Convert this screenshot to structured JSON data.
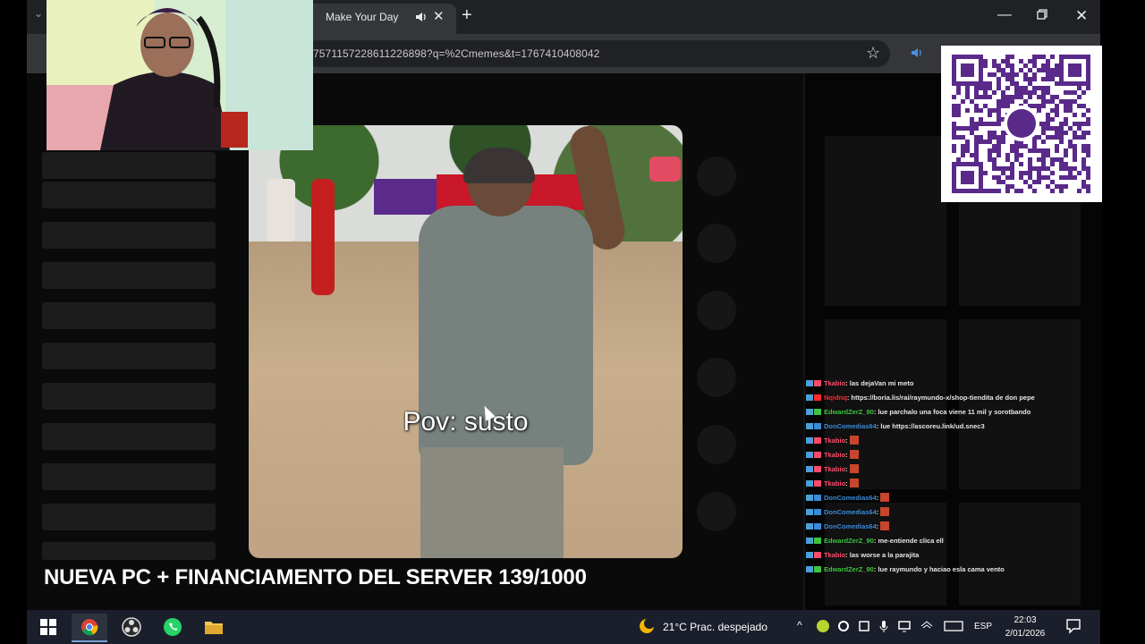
{
  "browser": {
    "tab_title": "Make Your Day",
    "tab_close": "✕",
    "new_tab": "+",
    "tab_menu": "⌄",
    "win_min": "—",
    "win_close": "✕",
    "url": "7571157228611226898?q=%2Cmemes&t=1767410408042",
    "star": "☆"
  },
  "video": {
    "caption": "Pov: susto"
  },
  "banner": {
    "text": "NUEVA PC + FINANCIAMENTO DEL SERVER 139/1000"
  },
  "chat": {
    "messages": [
      {
        "user": "Tkabio",
        "user_color": "#ff4a6a",
        "text": ": las dejaVan mi meto",
        "emote": false
      },
      {
        "user": "Nqidnq",
        "user_color": "#ff2a2a",
        "text": ": https://boria.lis/rai/raymundo-x/shop-tiendita de don pepe",
        "emote": false
      },
      {
        "user": "EdwardZerZ_90",
        "user_color": "#3ec33e",
        "text": ": lue parchalo una foca viene 11 mil y sorotbando",
        "emote": false
      },
      {
        "user": "DonComedias64",
        "user_color": "#3b8ad8",
        "text": ": lue https://ascoreu.link/ud.snec3",
        "emote": false
      },
      {
        "user": "Tkabio",
        "user_color": "#ff4a6a",
        "text": ":",
        "emote": true
      },
      {
        "user": "Tkabio",
        "user_color": "#ff4a6a",
        "text": ":",
        "emote": true
      },
      {
        "user": "Tkabio",
        "user_color": "#ff4a6a",
        "text": ":",
        "emote": true
      },
      {
        "user": "Tkabio",
        "user_color": "#ff4a6a",
        "text": ":",
        "emote": true
      },
      {
        "user": "DonComedias64",
        "user_color": "#3b8ad8",
        "text": ":",
        "emote": true
      },
      {
        "user": "DonComedias64",
        "user_color": "#3b8ad8",
        "text": ":",
        "emote": true
      },
      {
        "user": "DonComedias64",
        "user_color": "#3b8ad8",
        "text": ":",
        "emote": true
      },
      {
        "user": "EdwardZerZ_90",
        "user_color": "#3ec33e",
        "text": ": me-entiende clica ell",
        "emote": false
      },
      {
        "user": "Tkabio",
        "user_color": "#ff4a6a",
        "text": ": las worse a la parajita",
        "emote": false
      },
      {
        "user": "EdwardZerZ_90",
        "user_color": "#3ec33e",
        "text": ": lue raymundo y haciao esla cama vento",
        "emote": false
      }
    ]
  },
  "taskbar": {
    "weather": "21°C  Prac. despejado",
    "language": "ESP",
    "time": "22:03",
    "date": "2/01/2026",
    "chevron": "^"
  },
  "icons": {
    "audio": "speaker-icon",
    "maximize": "restore-icon",
    "windows": "windows-start-icon",
    "chrome": "chrome-icon",
    "obs": "obs-icon",
    "whatsapp": "whatsapp-icon",
    "folder": "folder-icon"
  },
  "colors": {
    "tabbar": "#202124",
    "toolbar": "#35363a",
    "taskbar": "#1b1f2b",
    "qr_purple": "#5a2a8a"
  }
}
